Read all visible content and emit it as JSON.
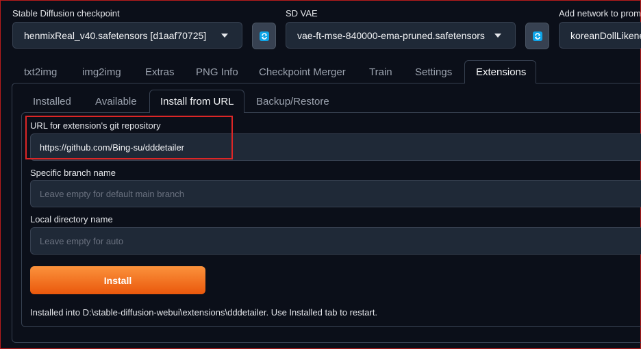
{
  "top": {
    "checkpoint": {
      "label": "Stable Diffusion checkpoint",
      "value": "henmixReal_v40.safetensors [d1aaf70725]"
    },
    "vae": {
      "label": "SD VAE",
      "value": "vae-ft-mse-840000-ema-pruned.safetensors"
    },
    "network": {
      "label": "Add network to prom",
      "value": "koreanDollLikene"
    }
  },
  "main_tabs": [
    "txt2img",
    "img2img",
    "Extras",
    "PNG Info",
    "Checkpoint Merger",
    "Train",
    "Settings",
    "Extensions"
  ],
  "sub_tabs": [
    "Installed",
    "Available",
    "Install from URL",
    "Backup/Restore"
  ],
  "form": {
    "url": {
      "label": "URL for extension's git repository",
      "value": "https://github.com/Bing-su/dddetailer"
    },
    "branch": {
      "label": "Specific branch name",
      "placeholder": "Leave empty for default main branch"
    },
    "dir": {
      "label": "Local directory name",
      "placeholder": "Leave empty for auto"
    },
    "install_label": "Install",
    "status": "Installed into D:\\stable-diffusion-webui\\extensions\\dddetailer. Use Installed tab to restart."
  },
  "colors": {
    "accent": "#f97316",
    "highlight": "#dc2626",
    "background": "#0b0f19"
  }
}
